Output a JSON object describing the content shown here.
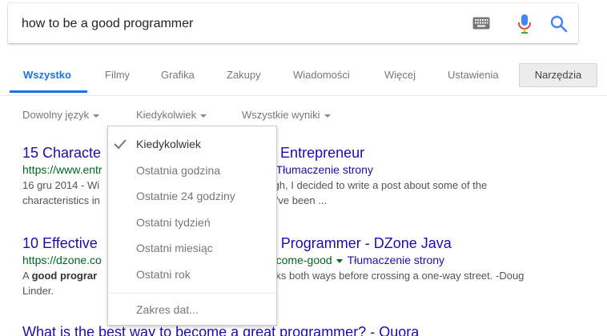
{
  "search": {
    "query": "how to be a good programmer"
  },
  "icons": {
    "keyboard": "keyboard-icon",
    "mic": "microphone-icon",
    "search": "search-icon"
  },
  "colors": {
    "accent": "#1a73e8",
    "link": "#1a0dab",
    "url": "#006621",
    "mic_blue": "#4285f4",
    "mic_red": "#ea4335",
    "mic_yellow": "#fbbc05",
    "mic_green": "#34a853"
  },
  "tabs": [
    {
      "label": "Wszystko",
      "active": true
    },
    {
      "label": "Filmy"
    },
    {
      "label": "Grafika"
    },
    {
      "label": "Zakupy"
    },
    {
      "label": "Wiadomości"
    },
    {
      "label": "Więcej"
    },
    {
      "label": "Ustawienia"
    }
  ],
  "tools_label": "Narzędzia",
  "filters": {
    "language": "Dowolny język",
    "time": "Kiedykolwiek",
    "results": "Wszystkie wyniki"
  },
  "dropdown": {
    "items": [
      {
        "label": "Kiedykolwiek",
        "selected": true
      },
      {
        "label": "Ostatnia godzina"
      },
      {
        "label": "Ostatnie 24 godziny"
      },
      {
        "label": "Ostatni tydzień"
      },
      {
        "label": "Ostatni miesiąc"
      },
      {
        "label": "Ostatni rok"
      }
    ],
    "custom_range": "Zakres dat..."
  },
  "results": [
    {
      "title_left": "15 Characte",
      "title_right": "mmer - Entrepreneur",
      "url_left": "https://www.entr",
      "translate": "Tłumaczenie strony",
      "snippet_l1_left": "16 gru 2014 - Wi",
      "snippet_l1_right": "ough, I decided to write a post about some of the",
      "snippet_l2_left": "characteristics in",
      "snippet_l2_right": "at I've been ..."
    },
    {
      "title_left": "10 Effective",
      "title_right": "od Programmer - DZone Java",
      "url_left": "https://dzone.co",
      "url_right": "ecome-good",
      "translate": "Tłumaczenie strony",
      "snippet_l1_left_a": "A ",
      "snippet_l1_left_b": "good prograr",
      "snippet_l1_right": "oks both ways before crossing a one-way street. -Doug",
      "snippet_l2": "Linder."
    },
    {
      "title": "What is the best way to become a great programmer? - Quora"
    }
  ]
}
